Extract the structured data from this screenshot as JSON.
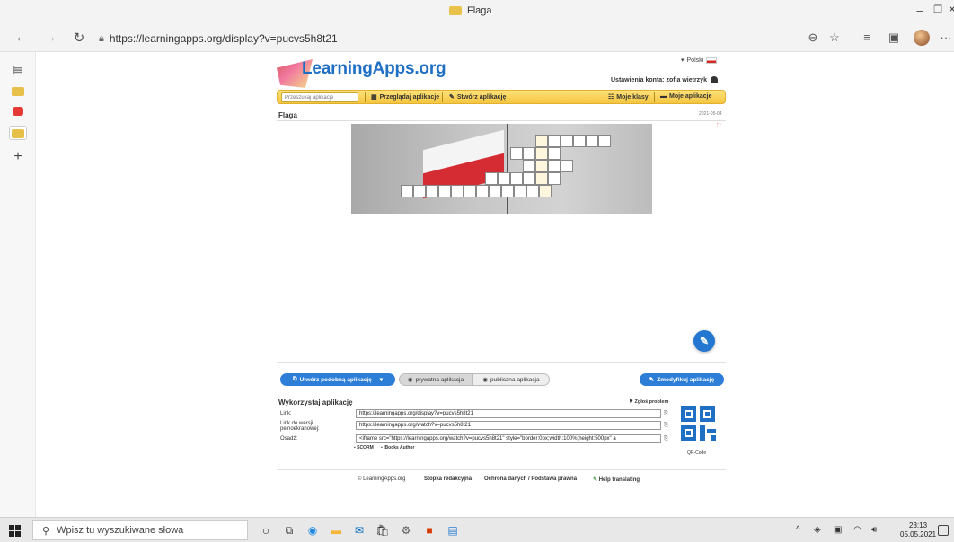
{
  "browser": {
    "tab_title": "Flaga",
    "url": "https://learningapps.org/display?v=pucvs5h8t21",
    "window_controls": {
      "minimize": "–",
      "maximize": "❐",
      "close": "✕"
    }
  },
  "page": {
    "logo_text": "LearningApps.org",
    "language": "Polski",
    "account_settings": "Ustawienia konta: zofia wietrzyk",
    "search_placeholder": "Przeszukaj aplikacje",
    "nav": {
      "browse": "Przeglądaj aplikacje",
      "create": "Stwórz aplikację",
      "my_classes": "Moje klasy",
      "my_apps": "Moje aplikacje"
    },
    "app_title": "Flaga",
    "app_date": "2021-05-04",
    "actions": {
      "create_similar": "Utwórz podobną aplikację",
      "private_app": "prywatna aplikacja",
      "public_app": "publiczna aplikacja",
      "modify_app": "Zmodyfikuj aplikację"
    },
    "use_section": {
      "title": "Wykorzystaj aplikację",
      "report_problem": "Zgłoś problem",
      "rows": [
        {
          "label": "Link:",
          "value": "https://learningapps.org/display?v=pucvs5h8t21"
        },
        {
          "label": "Link do wersji pełnoekranowej:",
          "value": "https://learningapps.org/watch?v=pucvs5h8t21"
        },
        {
          "label": "Osadź:",
          "value": "<iframe src=\"https://learningapps.org/watch?v=pucvs5h8t21\" style=\"border:0px;width:100%;height:500px\" a"
        }
      ],
      "scorm": "SCORM",
      "ibooks": "iBooks Author",
      "qr_label": "QR-Code"
    },
    "footer": {
      "copyright": "© LearningApps.org",
      "imprint": "Stopka redakcyjna",
      "privacy": "Ochrona danych / Podstawa prawna",
      "help": "Help translating"
    }
  },
  "taskbar": {
    "search_placeholder": "Wpisz tu wyszukiwane słowa",
    "time": "23:13",
    "date": "05.05.2021"
  },
  "colors": {
    "accent_blue": "#2c7ed6",
    "nav_yellow": "#f4c540",
    "flag_red": "#d52b33"
  }
}
